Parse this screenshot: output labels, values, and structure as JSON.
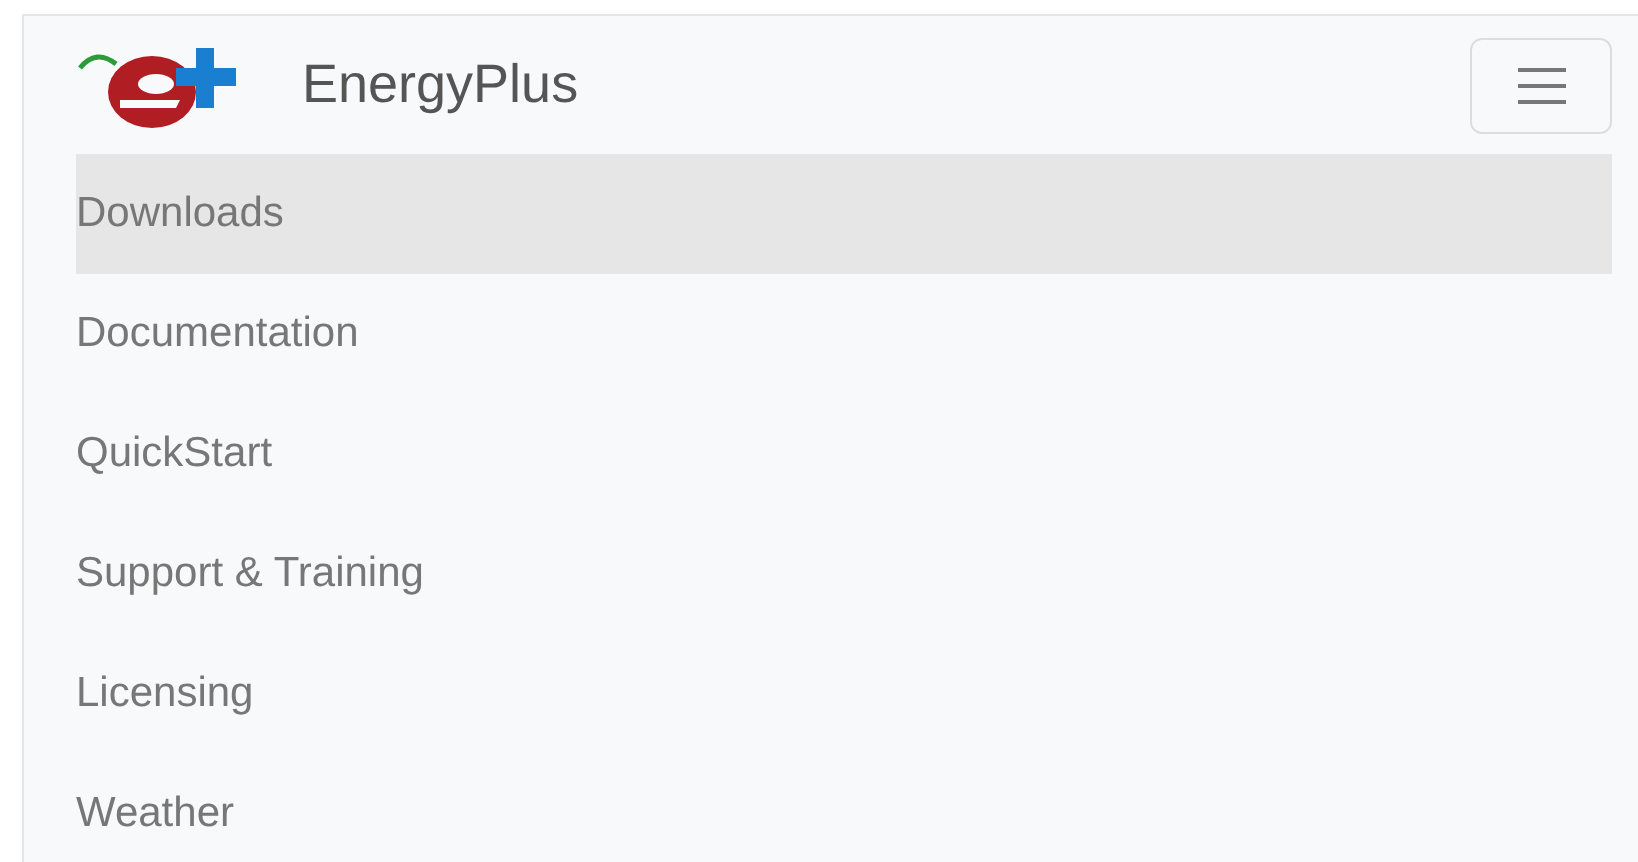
{
  "brand": {
    "name": "EnergyPlus"
  },
  "menu": [
    {
      "label": "Downloads",
      "selected": true
    },
    {
      "label": "Documentation",
      "selected": false
    },
    {
      "label": "QuickStart",
      "selected": false
    },
    {
      "label": "Support & Training",
      "selected": false
    },
    {
      "label": "Licensing",
      "selected": false
    },
    {
      "label": "Weather",
      "selected": false
    }
  ]
}
